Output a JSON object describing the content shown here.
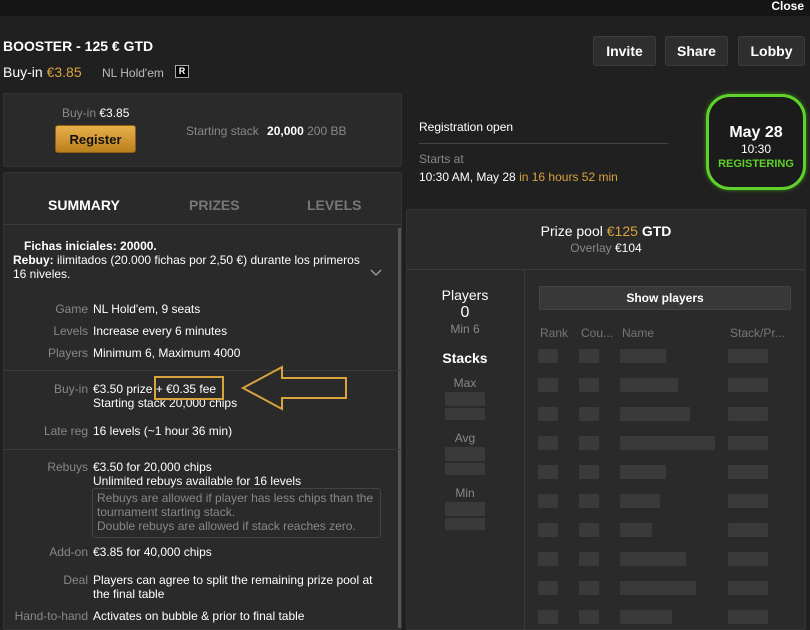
{
  "window": {
    "close_label": "Close"
  },
  "header": {
    "title": "BOOSTER - 125 € GTD",
    "buyin_label": "Buy-in",
    "buyin_value": "€3.85",
    "game": "NL Hold'em",
    "badge": "R",
    "invite_label": "Invite",
    "share_label": "Share",
    "lobby_label": "Lobby"
  },
  "register_panel": {
    "buyin_label": "Buy-in",
    "buyin_value": "€3.85",
    "register_label": "Register",
    "stack_label": "Starting stack",
    "stack_value": "20,000",
    "stack_bb": "200 BB"
  },
  "status": {
    "registration": "Registration open",
    "starts_label": "Starts at",
    "starts_value": "10:30 AM, May 28",
    "starts_in": "in 16 hours 52 min",
    "date": "May 28",
    "time": "10:30",
    "state": "REGISTERING",
    "ring_color": "#5fd12a"
  },
  "tabs": {
    "summary": "SUMMARY",
    "prizes": "PRIZES",
    "levels": "LEVELS"
  },
  "summary": {
    "note_line1": "Fichas iniciales: 20000.",
    "note_rebuy_label": "Rebuy:",
    "note_rebuy_text": " ilimitados (20.000 fichas por 2,50 €) durante los primeros",
    "note_line3": "16 niveles.",
    "game_label": "Game",
    "game_value": "NL Hold'em, 9 seats",
    "levels_label": "Levels",
    "levels_value": "Increase every 6 minutes",
    "players_label": "Players",
    "players_value": "Minimum 6, Maximum 4000",
    "buyin_label": "Buy-in",
    "buyin_prize": "€3.50 prize + ",
    "buyin_fee": "€0.35 fee",
    "buyin_stack": "Starting stack 20,000 chips",
    "latereg_label": "Late reg",
    "latereg_value": "16 levels (~1 hour 36 min)",
    "rebuys_label": "Rebuys",
    "rebuys_value1": "€3.50 for 20,000 chips",
    "rebuys_value2": "Unlimited rebuys available for 16 levels",
    "rebuys_note1": "Rebuys are allowed if player has less chips than the",
    "rebuys_note2": "tournament starting stack.",
    "rebuys_note3": "Double rebuys are allowed if stack reaches zero.",
    "addon_label": "Add-on",
    "addon_value": "€3.85 for 40,000 chips",
    "deal_label": "Deal",
    "deal_value1": "Players can agree to split the remaining prize pool at",
    "deal_value2": "the final table",
    "h2h_label": "Hand-to-hand",
    "h2h_value": "Activates on bubble & prior to final table"
  },
  "prize": {
    "label": "Prize pool",
    "amount": "€125",
    "gtd": "GTD",
    "overlay_label": "Overlay",
    "overlay_value": "€104"
  },
  "players": {
    "title": "Players",
    "count": "0",
    "min_label": "Min 6",
    "stacks_title": "Stacks",
    "max_label": "Max",
    "avg_label": "Avg",
    "min_stack_label": "Min",
    "show_label": "Show players",
    "columns": [
      "Rank",
      "Cou...",
      "Name",
      "Stack/Pr..."
    ]
  },
  "annotation_color": "#d9a33b"
}
